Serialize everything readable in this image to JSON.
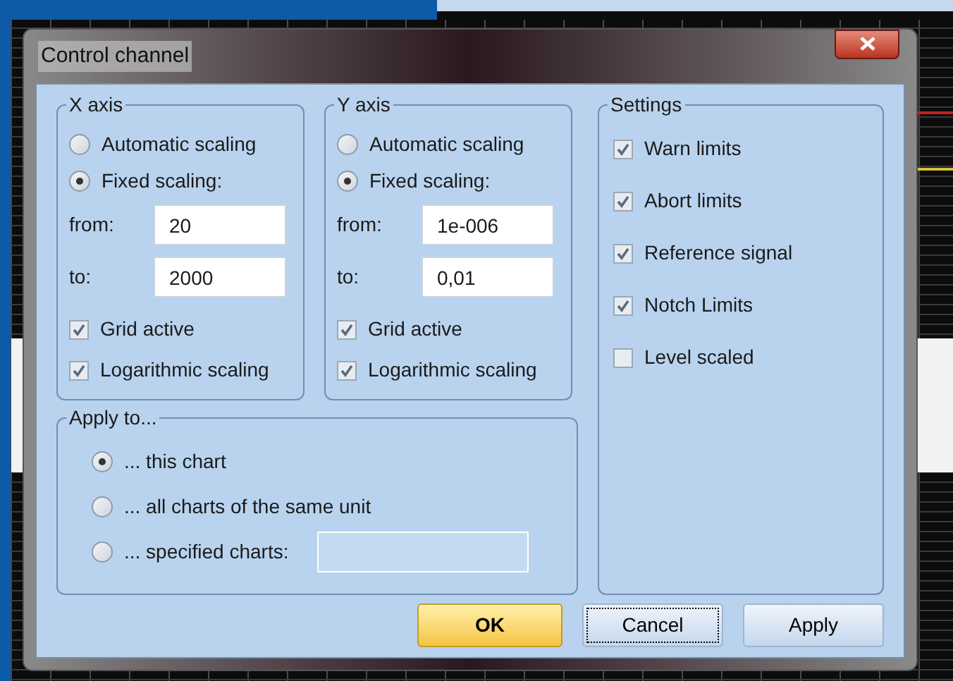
{
  "window": {
    "title": "Control channel"
  },
  "x_axis": {
    "title": "X axis",
    "options": [
      {
        "label": "Automatic scaling",
        "selected": false
      },
      {
        "label": "Fixed scaling:",
        "selected": true
      }
    ],
    "from": {
      "label": "from:",
      "value": "20"
    },
    "to": {
      "label": "to:",
      "value": "2000"
    },
    "checks": [
      {
        "label": "Grid active",
        "checked": true
      },
      {
        "label": "Logarithmic scaling",
        "checked": true
      }
    ]
  },
  "y_axis": {
    "title": "Y axis",
    "options": [
      {
        "label": "Automatic scaling",
        "selected": false
      },
      {
        "label": "Fixed scaling:",
        "selected": true
      }
    ],
    "from": {
      "label": "from:",
      "value": "1e-006"
    },
    "to": {
      "label": "to:",
      "value": "0,01"
    },
    "checks": [
      {
        "label": "Grid active",
        "checked": true
      },
      {
        "label": "Logarithmic scaling",
        "checked": true
      }
    ]
  },
  "settings": {
    "title": "Settings",
    "items": [
      {
        "label": "Warn limits",
        "checked": true
      },
      {
        "label": "Abort limits",
        "checked": true
      },
      {
        "label": "Reference signal",
        "checked": true
      },
      {
        "label": "Notch Limits",
        "checked": true
      },
      {
        "label": "Level scaled",
        "checked": false
      }
    ]
  },
  "apply_to": {
    "title": "Apply to...",
    "options": [
      {
        "label": "... this chart",
        "selected": true
      },
      {
        "label": "... all charts of the same unit",
        "selected": false
      },
      {
        "label": "... specified charts:",
        "selected": false
      }
    ],
    "field": {
      "disabled": true
    }
  },
  "buttons": [
    {
      "label": "OK",
      "default": true,
      "focused": false
    },
    {
      "label": "Cancel",
      "default": false,
      "focused": true
    },
    {
      "label": "Apply",
      "default": false,
      "focused": false
    }
  ]
}
